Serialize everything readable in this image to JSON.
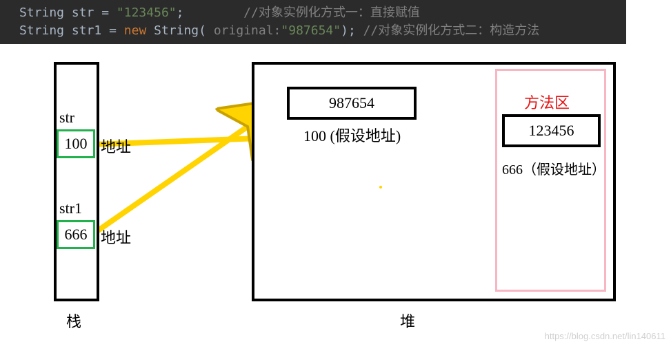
{
  "code": {
    "line1": {
      "type": "String",
      "var": "str",
      "op": "=",
      "lit": "\"123456\"",
      "semi": ";",
      "comment": "//对象实例化方式一：直接赋值"
    },
    "line2": {
      "type": "String",
      "var": "str1",
      "op": "=",
      "kw": "new",
      "cls": "String",
      "open": "(",
      "hint": "original:",
      "lit": "\"987654\"",
      "close": ")",
      "semi": ";",
      "comment": "//对象实例化方式二：构造方法"
    }
  },
  "stack": {
    "title": "栈",
    "var1_label": "str",
    "var1_value": "100",
    "var1_anno": "地址",
    "var2_label": "str1",
    "var2_value": "666",
    "var2_anno": "地址"
  },
  "heap": {
    "title": "堆",
    "obj_value": "987654",
    "obj_addr": "100 (假设地址)"
  },
  "method_area": {
    "title": "方法区",
    "pool_value": "123456",
    "pool_addr": "666（假设地址）"
  },
  "watermark": "https://blog.csdn.net/lin140611"
}
